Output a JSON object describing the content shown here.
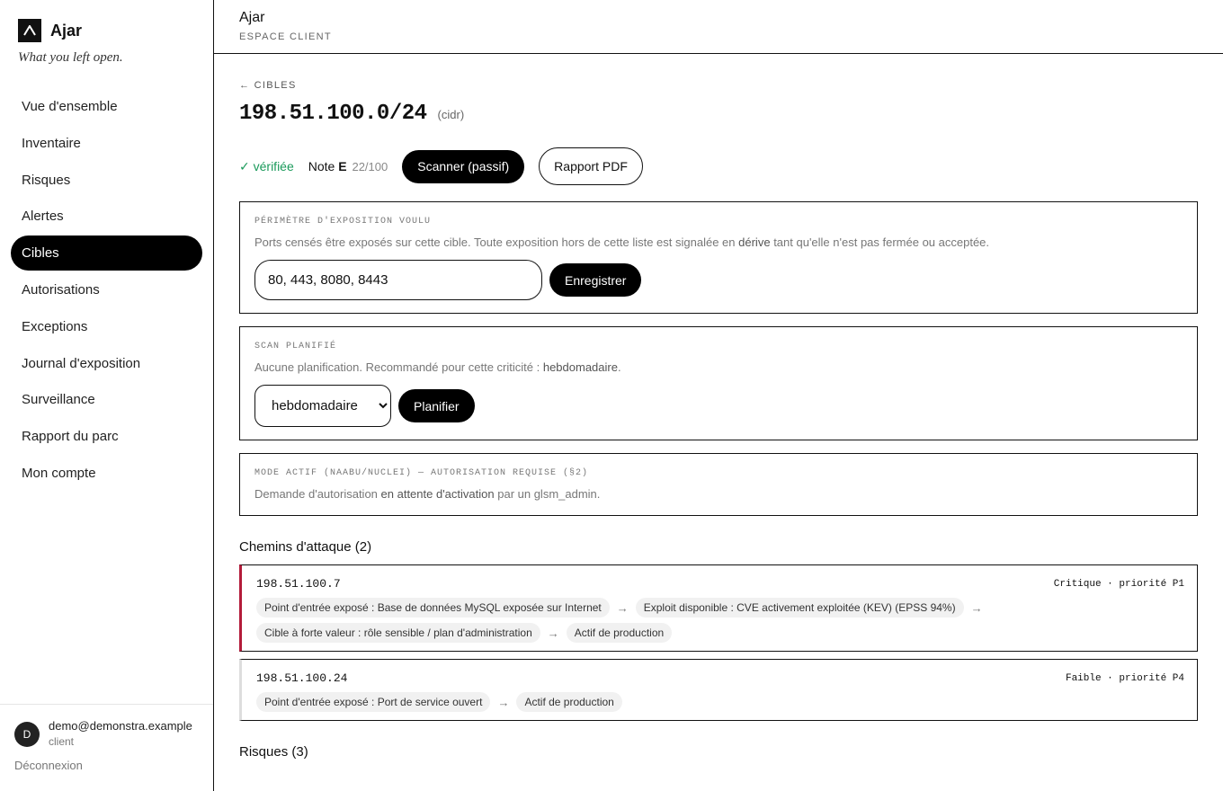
{
  "app": {
    "name": "Ajar",
    "tagline": "What you left open."
  },
  "sidebar": {
    "items": [
      {
        "label": "Vue d'ensemble"
      },
      {
        "label": "Inventaire"
      },
      {
        "label": "Risques"
      },
      {
        "label": "Alertes"
      },
      {
        "label": "Cibles",
        "active": true
      },
      {
        "label": "Autorisations"
      },
      {
        "label": "Exceptions"
      },
      {
        "label": "Journal d'exposition"
      },
      {
        "label": "Surveillance"
      },
      {
        "label": "Rapport du parc"
      },
      {
        "label": "Mon compte"
      }
    ],
    "user": {
      "initial": "D",
      "email": "demo@demonstra.example",
      "role": "client"
    },
    "logout": "Déconnexion"
  },
  "header": {
    "title": "Ajar",
    "subtitle": "ESPACE CLIENT"
  },
  "target": {
    "back_label": "← CIBLES",
    "name": "198.51.100.0/24",
    "kind": "(cidr)",
    "verified": "✓ vérifiée",
    "note_label": "Note",
    "grade": "E",
    "score": "22/100",
    "scan_button": "Scanner (passif)",
    "pdf_button": "Rapport PDF"
  },
  "perimeter": {
    "label": "PÉRIMÈTRE D'EXPOSITION VOULU",
    "text_before": "Ports censés être exposés sur cette cible. Toute exposition hors de cette liste est signalée en",
    "text_strong": "dérive",
    "text_after": "tant qu'elle n'est pas fermée ou acceptée.",
    "ports_value": "80, 443, 8080, 8443",
    "save_button": "Enregistrer"
  },
  "schedule": {
    "label": "SCAN PLANIFIÉ",
    "text_before": "Aucune planification. Recommandé pour cette criticité :",
    "text_strong": "hebdomadaire",
    "text_after": ".",
    "selected": "hebdomadaire",
    "plan_button": "Planifier"
  },
  "active_mode": {
    "label": "MODE ACTIF (NAABU/NUCLEI) — AUTORISATION REQUISE (§2)",
    "text_before": "Demande d'autorisation",
    "text_strong": "en attente d'activation",
    "text_after": "par un glsm_admin."
  },
  "attack_paths": {
    "title": "Chemins d'attaque (2)",
    "paths": [
      {
        "ip": "198.51.100.7",
        "priority": "Critique · priorité P1",
        "severity_color": "#b31b3a",
        "steps": [
          "Point d'entrée exposé : Base de données MySQL exposée sur Internet",
          "Exploit disponible : CVE activement exploitée (KEV) (EPSS 94%)",
          "Cible à forte valeur : rôle sensible / plan d'administration",
          "Actif de production"
        ]
      },
      {
        "ip": "198.51.100.24",
        "priority": "Faible · priorité P4",
        "severity_color": "#dddddd",
        "steps": [
          "Point d'entrée exposé : Port de service ouvert",
          "Actif de production"
        ]
      }
    ]
  },
  "risks": {
    "title": "Risques (3)"
  }
}
